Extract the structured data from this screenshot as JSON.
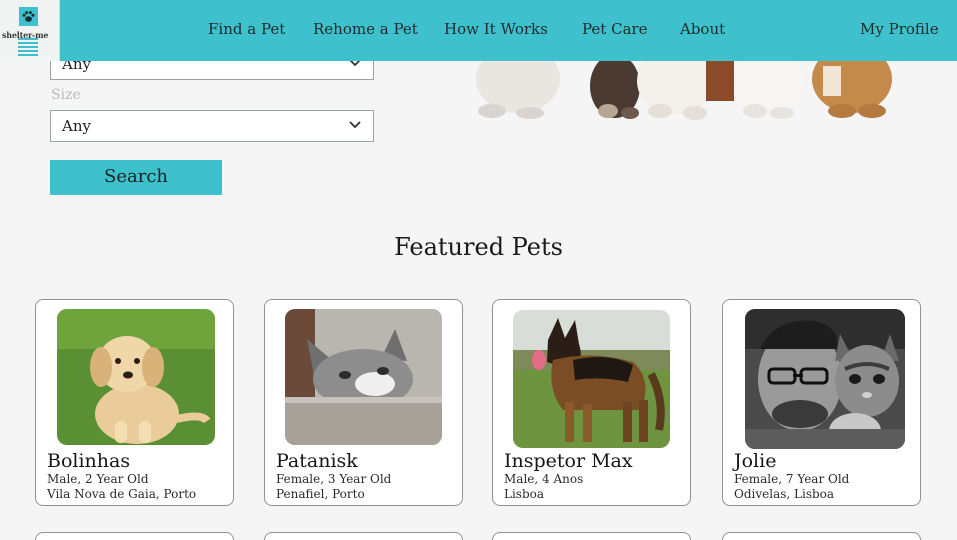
{
  "brand": {
    "logo_text": "shelter-me"
  },
  "nav": {
    "find_pet": "Find a Pet",
    "rehome_pet": "Rehome a Pet",
    "how_it_works": "How It Works",
    "pet_care": "Pet Care",
    "about": "About",
    "my_profile": "My Profile"
  },
  "search": {
    "first_select_value": "Any",
    "size_label": "Size",
    "size_value": "Any",
    "button_label": "Search"
  },
  "featured": {
    "title": "Featured Pets",
    "pets": [
      {
        "name": "Bolinhas",
        "details": "Male, 2 Year Old",
        "location": "Vila Nova de Gaia, Porto"
      },
      {
        "name": "Patanisk",
        "details": "Female, 3 Year Old",
        "location": "Penafiel, Porto"
      },
      {
        "name": "Inspetor Max",
        "details": "Male, 4 Anos",
        "location": "Lisboa"
      },
      {
        "name": "Jolie",
        "details": "Female, 7 Year Old",
        "location": "Odivelas, Lisboa"
      }
    ]
  },
  "colors": {
    "accent": "#3ec1cc",
    "page_bg": "#f4f5f4"
  }
}
